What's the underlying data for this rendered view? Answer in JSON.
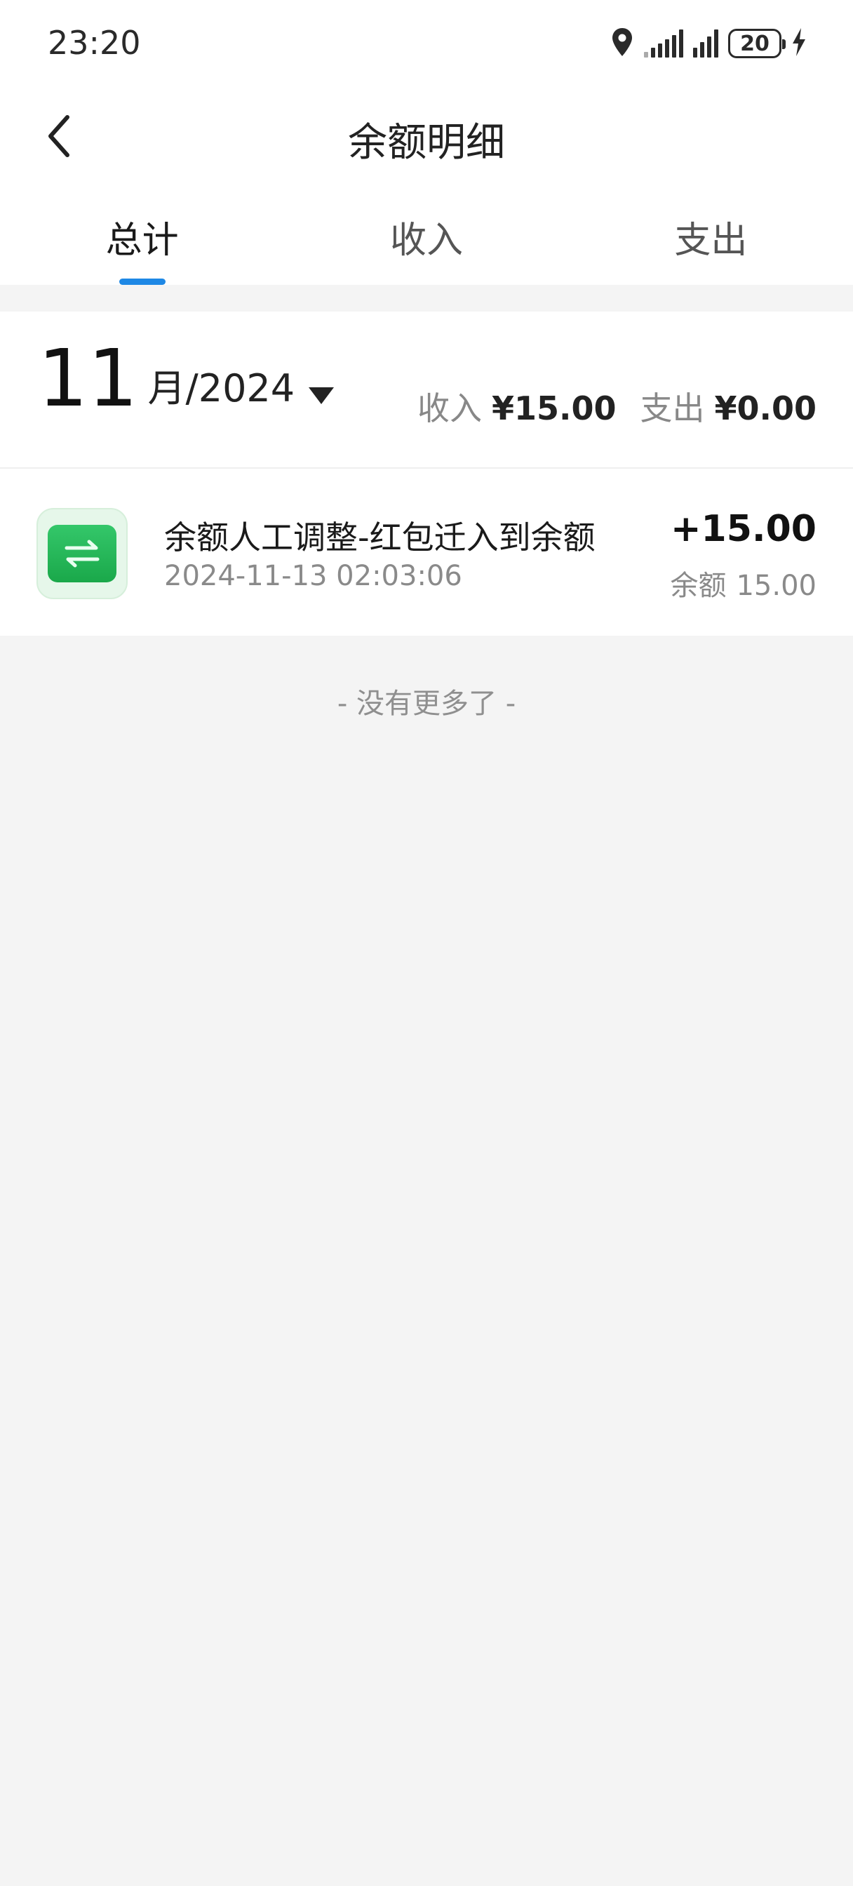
{
  "status_bar": {
    "time": "23:20",
    "battery": "20",
    "icons": [
      "location-icon",
      "signal-icon",
      "signal-icon",
      "battery-icon",
      "charging-icon"
    ]
  },
  "header": {
    "title": "余额明细",
    "back_icon": "chevron-left-icon"
  },
  "tabs": [
    {
      "label": "总计",
      "active": true
    },
    {
      "label": "收入",
      "active": false
    },
    {
      "label": "支出",
      "active": false
    }
  ],
  "month": {
    "number": "11",
    "suffix": "月/2024",
    "dropdown_icon": "caret-down-icon"
  },
  "summary": {
    "income_label": "收入",
    "income_value": "¥15.00",
    "expense_label": "支出",
    "expense_value": "¥0.00"
  },
  "records": [
    {
      "icon": "transfer-icon",
      "title": "余额人工调整-红包迁入到余额",
      "time": "2024-11-13 02:03:06",
      "amount": "+15.00",
      "balance_label": "余额",
      "balance_value": "15.00"
    }
  ],
  "footer": {
    "no_more": "- 没有更多了 -"
  },
  "colors": {
    "accent": "#1e88e5",
    "icon_green": "#1aa84a",
    "page_bg": "#f4f4f4"
  }
}
